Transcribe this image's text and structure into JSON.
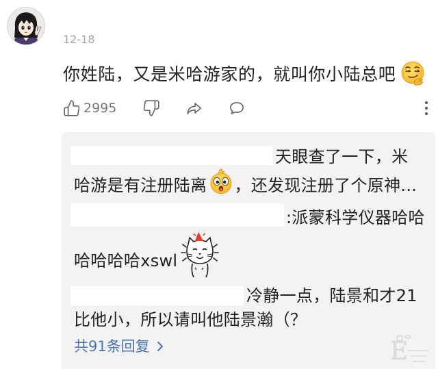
{
  "comment": {
    "avatar_icon": "anime-avatar",
    "date": "12-18",
    "text": "你姓陆，又是米哈游家的，就叫你小陆总吧",
    "emoji_icon": "smirk-face-emoji",
    "like_count": "2995"
  },
  "actions": {
    "like_icon": "thumbs-up-icon",
    "dislike_icon": "thumbs-down-icon",
    "share_icon": "share-icon",
    "reply_icon": "comment-bubble-icon",
    "more_icon": "more-vertical-icon"
  },
  "replies": [
    {
      "username_redacted": true,
      "line1": "天眼查了一下，米",
      "line2_before_emoji": "哈游是有注册陆离",
      "emoji_icon": "surprised-face-emoji",
      "line2_after_emoji": "，还发现注册了个原神..."
    },
    {
      "username_redacted": true,
      "line1": ":派蒙科学仪器哈哈",
      "line2": "哈哈哈哈xswl",
      "sticker_icon": "cat-sticker"
    },
    {
      "username_redacted": true,
      "line1": "冷静一点，陆景和才21",
      "line2": "比他小，所以请叫他陆景瀚（？"
    }
  ],
  "more_replies": {
    "label": "共91条回复",
    "icon": "chevron-right-icon"
  },
  "watermark": {
    "letter": "E"
  },
  "colors": {
    "text": "#222222",
    "muted": "#a6a6a6",
    "icon": "#666666",
    "link": "#4a74b8",
    "reply_background": "#f3f3f3",
    "redaction": "#ffffff"
  }
}
